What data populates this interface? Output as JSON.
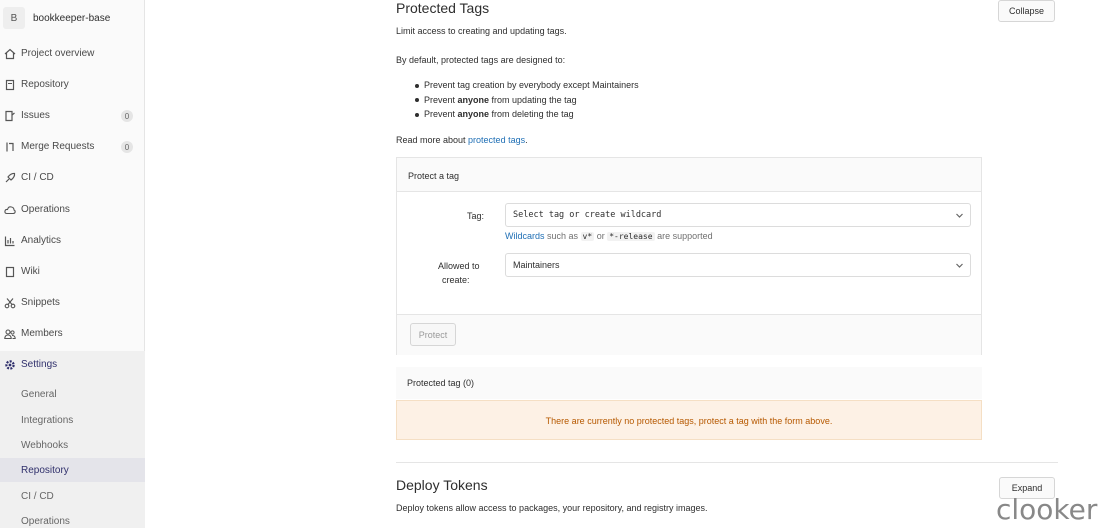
{
  "project": {
    "avatar_letter": "B",
    "name": "bookkeeper-base"
  },
  "sidebar": {
    "items": [
      {
        "label": "Project overview",
        "icon": "home-icon"
      },
      {
        "label": "Repository",
        "icon": "doc-icon"
      },
      {
        "label": "Issues",
        "icon": "issues-icon",
        "count": "0"
      },
      {
        "label": "Merge Requests",
        "icon": "merge-request-icon",
        "count": "0"
      },
      {
        "label": "CI / CD",
        "icon": "rocket-icon"
      },
      {
        "label": "Operations",
        "icon": "cloud-icon"
      },
      {
        "label": "Analytics",
        "icon": "chart-icon"
      },
      {
        "label": "Wiki",
        "icon": "book-icon"
      },
      {
        "label": "Snippets",
        "icon": "scissors-icon"
      },
      {
        "label": "Members",
        "icon": "users-icon"
      },
      {
        "label": "Settings",
        "icon": "gear-icon"
      }
    ],
    "settings_sub": [
      "General",
      "Integrations",
      "Webhooks",
      "Repository",
      "CI / CD",
      "Operations"
    ]
  },
  "protected_tags": {
    "title": "Protected Tags",
    "collapse_label": "Collapse",
    "subtitle": "Limit access to creating and updating tags.",
    "intro": "By default, protected tags are designed to:",
    "bullets": [
      {
        "pre": "Prevent tag creation by everybody except Maintainers",
        "bold": "",
        "post": ""
      },
      {
        "pre": "Prevent ",
        "bold": "anyone",
        "post": " from updating the tag"
      },
      {
        "pre": "Prevent ",
        "bold": "anyone",
        "post": " from deleting the tag"
      }
    ],
    "read_more_prefix": "Read more about ",
    "read_more_link": "protected tags",
    "read_more_suffix": "."
  },
  "protect_form": {
    "title": "Protect a tag",
    "tag_label": "Tag:",
    "tag_placeholder": "Select tag or create wildcard",
    "wildcard_link": "Wildcards",
    "wildcard_mid": " such as ",
    "wildcard_ex1": "v*",
    "wildcard_or": " or ",
    "wildcard_ex2": "*-release",
    "wildcard_suffix": " are supported",
    "allowed_label_1": "Allowed to",
    "allowed_label_2": "create:",
    "allowed_value": "Maintainers",
    "protect_button": "Protect"
  },
  "protected_list": {
    "header": "Protected tag (0)",
    "empty": "There are currently no protected tags, protect a tag with the form above."
  },
  "deploy_tokens": {
    "title": "Deploy Tokens",
    "expand_label": "Expand",
    "description": "Deploy tokens allow access to packages, your repository, and registry images."
  },
  "watermark": "clooker",
  "colors": {
    "link": "#1f6fb5",
    "warning_text": "#b65900",
    "warning_bg": "#fdf1e5"
  }
}
